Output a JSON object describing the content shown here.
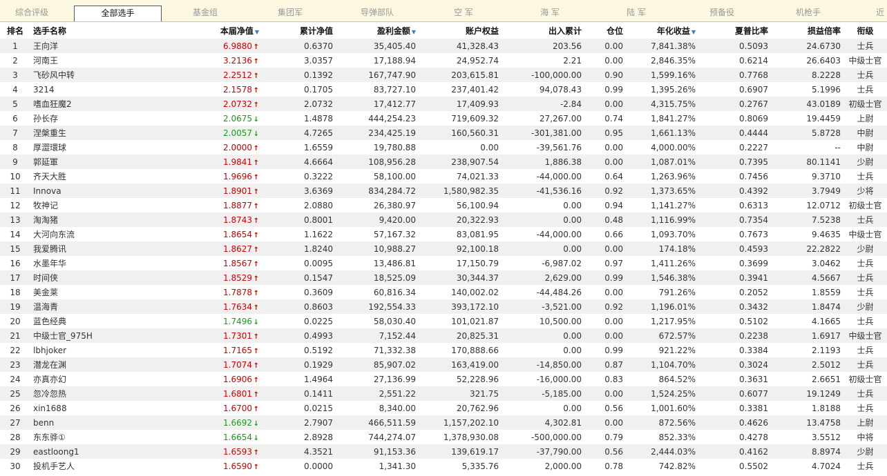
{
  "tabs": [
    "综合评级",
    "全部选手",
    "基金组",
    "集团军",
    "导弹部队",
    "空 军",
    "海 军",
    "陆 军",
    "预备役",
    "机枪手",
    "近"
  ],
  "active_tab": 1,
  "headers": {
    "rank": "排名",
    "name": "选手名称",
    "nav": "本届净值",
    "cum_nav": "累计净值",
    "profit": "盈利金额",
    "equity": "账户权益",
    "flow": "出入累计",
    "position": "仓位",
    "annual": "年化收益",
    "sharpe": "夏普比率",
    "pl_ratio": "损益倍率",
    "title": "衔级"
  },
  "sort_icon": "sort-down-icon",
  "colors": {
    "up": "#c00000",
    "down": "#1a9a1a",
    "stripe": "#f0f0f0"
  },
  "rows": [
    {
      "rank": "1",
      "name": "王向洋",
      "nav": "6.9880",
      "dir": "up",
      "cum_nav": "0.6370",
      "profit": "35,405.40",
      "equity": "41,328.43",
      "flow": "203.56",
      "position": "0.00",
      "annual": "7,841.38%",
      "sharpe": "0.5093",
      "pl_ratio": "24.6730",
      "title": "士兵"
    },
    {
      "rank": "2",
      "name": "河南王",
      "nav": "3.2136",
      "dir": "up",
      "cum_nav": "3.0357",
      "profit": "17,188.94",
      "equity": "24,952.74",
      "flow": "2.21",
      "position": "0.00",
      "annual": "2,846.35%",
      "sharpe": "0.6214",
      "pl_ratio": "26.6403",
      "title": "中级士官"
    },
    {
      "rank": "3",
      "name": "飞砂风中转",
      "nav": "2.2512",
      "dir": "up",
      "cum_nav": "0.1392",
      "profit": "167,747.90",
      "equity": "203,615.81",
      "flow": "-100,000.00",
      "position": "0.90",
      "annual": "1,599.16%",
      "sharpe": "0.7768",
      "pl_ratio": "8.2228",
      "title": "士兵"
    },
    {
      "rank": "4",
      "name": "3214",
      "nav": "2.1578",
      "dir": "up",
      "cum_nav": "0.1705",
      "profit": "83,727.10",
      "equity": "237,401.42",
      "flow": "94,078.43",
      "position": "0.99",
      "annual": "1,395.26%",
      "sharpe": "0.6907",
      "pl_ratio": "5.1996",
      "title": "士兵"
    },
    {
      "rank": "5",
      "name": "嗜血狂魔2",
      "nav": "2.0732",
      "dir": "up",
      "cum_nav": "2.0732",
      "profit": "17,412.77",
      "equity": "17,409.93",
      "flow": "-2.84",
      "position": "0.00",
      "annual": "4,315.75%",
      "sharpe": "0.2767",
      "pl_ratio": "43.0189",
      "title": "初级士官"
    },
    {
      "rank": "6",
      "name": "孙长存",
      "nav": "2.0675",
      "dir": "down",
      "cum_nav": "1.4878",
      "profit": "444,254.23",
      "equity": "719,609.32",
      "flow": "27,267.00",
      "position": "0.74",
      "annual": "1,841.27%",
      "sharpe": "0.8069",
      "pl_ratio": "19.4459",
      "title": "上尉"
    },
    {
      "rank": "7",
      "name": "涅槃重生",
      "nav": "2.0057",
      "dir": "down",
      "cum_nav": "4.7265",
      "profit": "234,425.19",
      "equity": "160,560.31",
      "flow": "-301,381.00",
      "position": "0.95",
      "annual": "1,661.13%",
      "sharpe": "0.4444",
      "pl_ratio": "5.8728",
      "title": "中尉"
    },
    {
      "rank": "8",
      "name": "厚澀環球",
      "nav": "2.0000",
      "dir": "up",
      "cum_nav": "1.6559",
      "profit": "19,780.88",
      "equity": "0.00",
      "flow": "-39,561.76",
      "position": "0.00",
      "annual": "4,000.00%",
      "sharpe": "0.2227",
      "pl_ratio": "--",
      "title": "中尉"
    },
    {
      "rank": "9",
      "name": "郭延軍",
      "nav": "1.9841",
      "dir": "up",
      "cum_nav": "4.6664",
      "profit": "108,956.28",
      "equity": "238,907.54",
      "flow": "1,886.38",
      "position": "0.00",
      "annual": "1,087.01%",
      "sharpe": "0.7395",
      "pl_ratio": "80.1141",
      "title": "少尉"
    },
    {
      "rank": "10",
      "name": "齐天大胜",
      "nav": "1.9696",
      "dir": "up",
      "cum_nav": "0.3222",
      "profit": "58,100.00",
      "equity": "74,021.33",
      "flow": "-44,000.00",
      "position": "0.64",
      "annual": "1,263.96%",
      "sharpe": "0.7456",
      "pl_ratio": "9.3710",
      "title": "士兵"
    },
    {
      "rank": "11",
      "name": "Innova",
      "nav": "1.8901",
      "dir": "up",
      "cum_nav": "3.6369",
      "profit": "834,284.72",
      "equity": "1,580,982.35",
      "flow": "-41,536.16",
      "position": "0.92",
      "annual": "1,373.65%",
      "sharpe": "0.4392",
      "pl_ratio": "3.7949",
      "title": "少将"
    },
    {
      "rank": "12",
      "name": "牧神记",
      "nav": "1.8877",
      "dir": "up",
      "cum_nav": "2.0880",
      "profit": "26,380.97",
      "equity": "56,100.94",
      "flow": "0.00",
      "position": "0.94",
      "annual": "1,141.27%",
      "sharpe": "0.6313",
      "pl_ratio": "12.0712",
      "title": "初级士官"
    },
    {
      "rank": "13",
      "name": "淘淘猪",
      "nav": "1.8743",
      "dir": "up",
      "cum_nav": "0.8001",
      "profit": "9,420.00",
      "equity": "20,322.93",
      "flow": "0.00",
      "position": "0.48",
      "annual": "1,116.99%",
      "sharpe": "0.7354",
      "pl_ratio": "7.5238",
      "title": "士兵"
    },
    {
      "rank": "14",
      "name": "大河向东流",
      "nav": "1.8654",
      "dir": "up",
      "cum_nav": "1.1622",
      "profit": "57,167.32",
      "equity": "83,081.95",
      "flow": "-44,000.00",
      "position": "0.66",
      "annual": "1,093.70%",
      "sharpe": "0.7673",
      "pl_ratio": "9.4635",
      "title": "中级士官"
    },
    {
      "rank": "15",
      "name": "我爱腾讯",
      "nav": "1.8627",
      "dir": "up",
      "cum_nav": "1.8240",
      "profit": "10,988.27",
      "equity": "92,100.18",
      "flow": "0.00",
      "position": "0.00",
      "annual": "174.18%",
      "sharpe": "0.4593",
      "pl_ratio": "22.2822",
      "title": "少尉"
    },
    {
      "rank": "16",
      "name": "水墨年华",
      "nav": "1.8567",
      "dir": "up",
      "cum_nav": "0.0095",
      "profit": "13,486.81",
      "equity": "17,150.79",
      "flow": "-6,987.02",
      "position": "0.97",
      "annual": "1,411.26%",
      "sharpe": "0.3699",
      "pl_ratio": "3.0462",
      "title": "士兵"
    },
    {
      "rank": "17",
      "name": "时间侠",
      "nav": "1.8529",
      "dir": "up",
      "cum_nav": "0.1547",
      "profit": "18,525.09",
      "equity": "30,344.37",
      "flow": "2,629.00",
      "position": "0.99",
      "annual": "1,546.38%",
      "sharpe": "0.3941",
      "pl_ratio": "4.5667",
      "title": "士兵"
    },
    {
      "rank": "18",
      "name": "美金莱",
      "nav": "1.7878",
      "dir": "up",
      "cum_nav": "0.3609",
      "profit": "60,816.34",
      "equity": "140,002.02",
      "flow": "-44,484.26",
      "position": "0.00",
      "annual": "791.26%",
      "sharpe": "0.2052",
      "pl_ratio": "1.8559",
      "title": "士兵"
    },
    {
      "rank": "19",
      "name": "温海青",
      "nav": "1.7634",
      "dir": "up",
      "cum_nav": "0.8603",
      "profit": "192,554.33",
      "equity": "393,172.10",
      "flow": "-3,521.00",
      "position": "0.92",
      "annual": "1,196.01%",
      "sharpe": "0.3432",
      "pl_ratio": "1.8474",
      "title": "少尉"
    },
    {
      "rank": "20",
      "name": "蓝色经典",
      "nav": "1.7496",
      "dir": "down",
      "cum_nav": "0.0225",
      "profit": "58,030.40",
      "equity": "101,021.87",
      "flow": "10,500.00",
      "position": "0.00",
      "annual": "1,217.95%",
      "sharpe": "0.5102",
      "pl_ratio": "4.1665",
      "title": "士兵"
    },
    {
      "rank": "21",
      "name": "中级士官_975H",
      "nav": "1.7301",
      "dir": "up",
      "cum_nav": "0.4993",
      "profit": "7,152.44",
      "equity": "20,825.31",
      "flow": "0.00",
      "position": "0.00",
      "annual": "672.57%",
      "sharpe": "0.2238",
      "pl_ratio": "1.6917",
      "title": "中级士官"
    },
    {
      "rank": "22",
      "name": "lbhjoker",
      "nav": "1.7165",
      "dir": "up",
      "cum_nav": "0.5192",
      "profit": "71,332.38",
      "equity": "170,888.66",
      "flow": "0.00",
      "position": "0.99",
      "annual": "921.22%",
      "sharpe": "0.3384",
      "pl_ratio": "2.1193",
      "title": "士兵"
    },
    {
      "rank": "23",
      "name": "潜龙在渊",
      "nav": "1.7074",
      "dir": "up",
      "cum_nav": "0.1929",
      "profit": "85,907.02",
      "equity": "163,419.00",
      "flow": "-14,850.00",
      "position": "0.87",
      "annual": "1,104.70%",
      "sharpe": "0.3024",
      "pl_ratio": "2.5012",
      "title": "士兵"
    },
    {
      "rank": "24",
      "name": "亦真亦幻",
      "nav": "1.6906",
      "dir": "up",
      "cum_nav": "1.4964",
      "profit": "27,136.99",
      "equity": "52,228.96",
      "flow": "-16,000.00",
      "position": "0.83",
      "annual": "864.52%",
      "sharpe": "0.3631",
      "pl_ratio": "2.6651",
      "title": "初级士官"
    },
    {
      "rank": "25",
      "name": "忽冷忽热",
      "nav": "1.6801",
      "dir": "up",
      "cum_nav": "0.1411",
      "profit": "2,551.22",
      "equity": "321.75",
      "flow": "-5,185.00",
      "position": "0.00",
      "annual": "1,524.25%",
      "sharpe": "0.6077",
      "pl_ratio": "19.1249",
      "title": "士兵"
    },
    {
      "rank": "26",
      "name": "xin1688",
      "nav": "1.6700",
      "dir": "up",
      "cum_nav": "0.0215",
      "profit": "8,340.00",
      "equity": "20,762.96",
      "flow": "0.00",
      "position": "0.56",
      "annual": "1,001.60%",
      "sharpe": "0.3381",
      "pl_ratio": "1.8188",
      "title": "士兵"
    },
    {
      "rank": "27",
      "name": "benn",
      "nav": "1.6692",
      "dir": "down",
      "cum_nav": "2.7907",
      "profit": "466,511.59",
      "equity": "1,157,202.10",
      "flow": "4,302.81",
      "position": "0.00",
      "annual": "872.56%",
      "sharpe": "0.4626",
      "pl_ratio": "13.4758",
      "title": "上尉"
    },
    {
      "rank": "28",
      "name": "东东骅①",
      "nav": "1.6654",
      "dir": "down",
      "cum_nav": "2.8928",
      "profit": "744,274.07",
      "equity": "1,378,930.08",
      "flow": "-500,000.00",
      "position": "0.79",
      "annual": "852.33%",
      "sharpe": "0.4278",
      "pl_ratio": "3.5512",
      "title": "中将"
    },
    {
      "rank": "29",
      "name": "eastloong1",
      "nav": "1.6593",
      "dir": "up",
      "cum_nav": "4.3521",
      "profit": "91,153.36",
      "equity": "139,619.17",
      "flow": "-37,790.00",
      "position": "0.56",
      "annual": "2,444.03%",
      "sharpe": "0.4162",
      "pl_ratio": "8.8974",
      "title": "少尉"
    },
    {
      "rank": "30",
      "name": "投机手艺人",
      "nav": "1.6590",
      "dir": "up",
      "cum_nav": "0.0000",
      "profit": "1,341.30",
      "equity": "5,335.76",
      "flow": "2,000.00",
      "position": "0.78",
      "annual": "742.82%",
      "sharpe": "0.5502",
      "pl_ratio": "4.7024",
      "title": "士兵"
    }
  ]
}
